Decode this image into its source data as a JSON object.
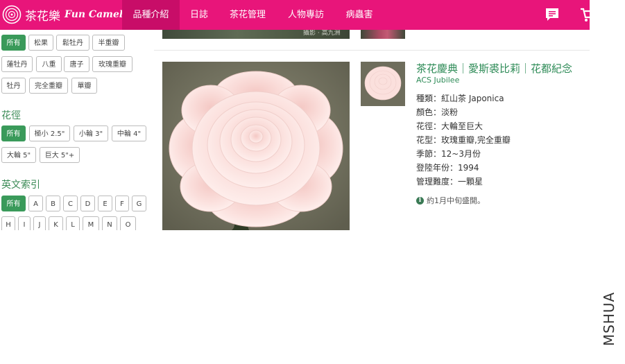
{
  "brand": {
    "name_cn": "茶花樂",
    "name_en": "Fun Camellia"
  },
  "nav": {
    "items": [
      {
        "label": "品種介紹",
        "active": true
      },
      {
        "label": "日誌"
      },
      {
        "label": "茶花管理"
      },
      {
        "label": "人物專訪"
      },
      {
        "label": "病蟲害"
      }
    ],
    "icons": [
      "chat-icon",
      "cart-icon"
    ]
  },
  "filters": {
    "form": [
      "所有",
      "松果",
      "鬆牡丹",
      "半重瓣",
      "蓮牡丹",
      "八重",
      "唐子",
      "玫瑰重瓣",
      "牡丹",
      "完全重瓣",
      "單瓣"
    ],
    "size_title": "花徑",
    "size": [
      "所有",
      "極小 2.5\"",
      "小輪 3\"",
      "中輪 4\"",
      "大輪 5\"",
      "巨大 5\"+"
    ],
    "alpha_title": "英文索引",
    "alpha": [
      "所有",
      "A",
      "B",
      "C",
      "D",
      "E",
      "F",
      "G",
      "H",
      "I",
      "J",
      "K",
      "L",
      "M",
      "N",
      "O"
    ]
  },
  "strip": {
    "caption": "攝影 · 高九洲"
  },
  "card": {
    "title": "茶花慶典｜愛斯裘比莉｜花都紀念",
    "subtitle": "ACS Jubilee",
    "details": [
      "種類：紅山茶 Japonica",
      "顏色：淡粉",
      "花徑：大輪至巨大",
      "花型：玫瑰重瓣,完全重瓣",
      "季節：12~3月份",
      "登陸年份：1994",
      "管理難度：一顆星"
    ],
    "bloom_note": "約1月中旬盛開。"
  },
  "watermark": "MSHUA",
  "colors": {
    "nav": "#e8157a",
    "nav_active": "#c80d68",
    "accent": "#3a9a5a",
    "title": "#2e8b57"
  }
}
